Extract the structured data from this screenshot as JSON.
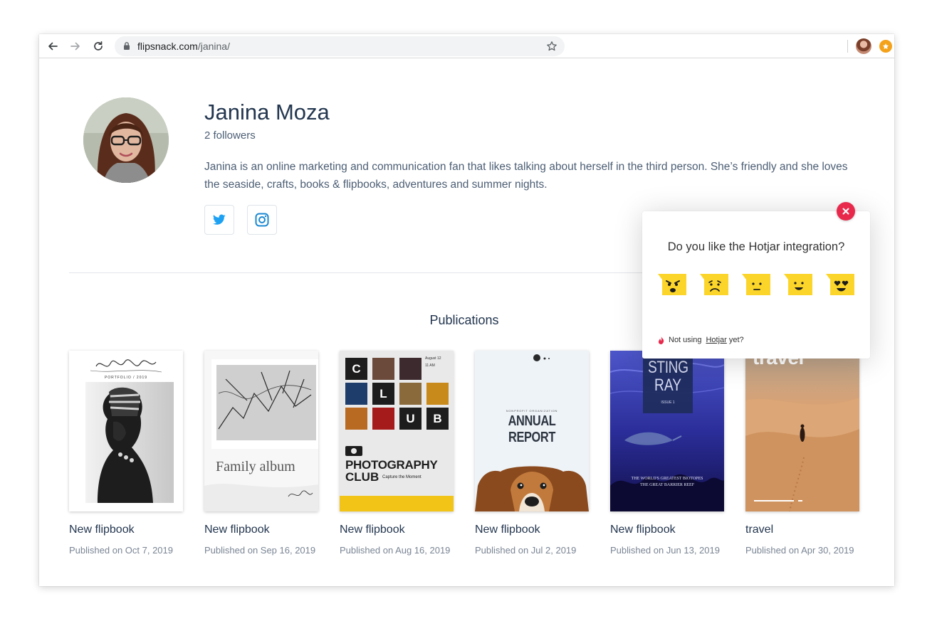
{
  "browser": {
    "url_host": "flipsnack.com",
    "url_path": "/janina/"
  },
  "profile": {
    "name": "Janina Moza",
    "followers": "2 followers",
    "bio": "Janina is an online marketing and communication fan that likes talking about herself in the third person. She’s friendly and she loves the seaside, crafts, books & flipbooks, adventures and summer nights.",
    "social": [
      "twitter-icon",
      "instagram-icon"
    ]
  },
  "publications": {
    "title": "Publications",
    "items": [
      {
        "title": "New flipbook",
        "date": "Published on Oct 7, 2019",
        "cover_text": "Portfolio / 2019"
      },
      {
        "title": "New flipbook",
        "date": "Published on Sep 16, 2019",
        "cover_text": "Family album"
      },
      {
        "title": "New flipbook",
        "date": "Published on Aug 16, 2019",
        "cover_text": "PHOTOGRAPHY CLUB"
      },
      {
        "title": "New flipbook",
        "date": "Published on Jul 2, 2019",
        "cover_text": "ANNUAL REPORT"
      },
      {
        "title": "New flipbook",
        "date": "Published on Jun 13, 2019",
        "cover_text": "STING RAY"
      },
      {
        "title": "travel",
        "date": "Published on Apr 30, 2019",
        "cover_text": "travel"
      }
    ]
  },
  "covers": {
    "portfolio_sub": "PORTFOLIO / 2019",
    "family_title": "Family album",
    "club_letters": [
      "C",
      "L",
      "U",
      "B"
    ],
    "club_date": "August 12",
    "club_time": "11 AM",
    "club_title": "PHOTOGRAPHY",
    "club_title2": "CLUB",
    "club_tag": "Capture the Moment",
    "annual_sub": "NONPROFIT ORGANIZATION",
    "annual_title": "ANNUAL REPORT",
    "sting_line1": "STING",
    "sting_line2": "RAY",
    "sting_issue": "ISSUE 1",
    "sting_caption1": "THE WORLD'S GREATEST BIOTOPES",
    "sting_caption2": "THE GREAT BARRIER REEF",
    "travel_title": "travel"
  },
  "hotjar": {
    "question": "Do you like the Hotjar integration?",
    "foot_prefix": "Not using",
    "foot_link": "Hotjar",
    "foot_suffix": "yet?",
    "ratings": [
      "hate-emoji",
      "dislike-emoji",
      "neutral-emoji",
      "like-emoji",
      "love-emoji"
    ]
  },
  "colors": {
    "heading": "#23364f",
    "body_text": "#4c5e74",
    "twitter": "#1da1f2",
    "instagram": "#1b88d1",
    "hotjar_close": "#e8294c",
    "emoji_yellow": "#fcd52a"
  }
}
